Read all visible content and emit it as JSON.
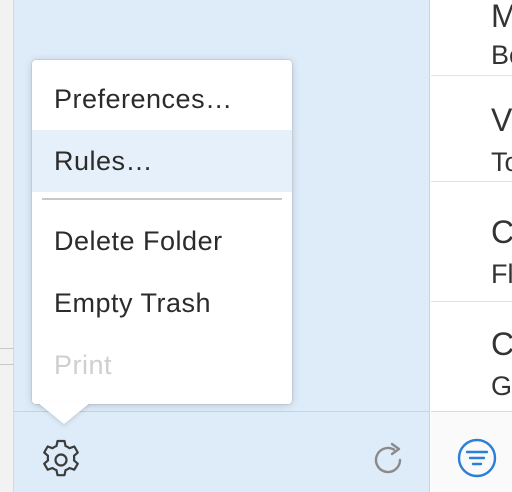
{
  "menu": {
    "items": [
      {
        "label": "Preferences…"
      },
      {
        "label": "Rules…"
      },
      {
        "label": "Delete Folder"
      },
      {
        "label": "Empty Trash"
      },
      {
        "label": "Print"
      }
    ]
  },
  "messages": [
    {
      "line1": "M",
      "line2": "Bo"
    },
    {
      "line1": "V",
      "line2": "To"
    },
    {
      "line1": "C",
      "line2": "Fl"
    },
    {
      "line1": "C",
      "line2": "G"
    }
  ],
  "icons": {
    "settings": "gear-icon",
    "refresh": "refresh-icon",
    "filter": "filter-icon"
  },
  "colors": {
    "sidebar_bg": "#deecf9",
    "menu_highlight": "#e6f0fb",
    "accent": "#2b7fd8",
    "disabled_text": "#cfcfcf"
  }
}
